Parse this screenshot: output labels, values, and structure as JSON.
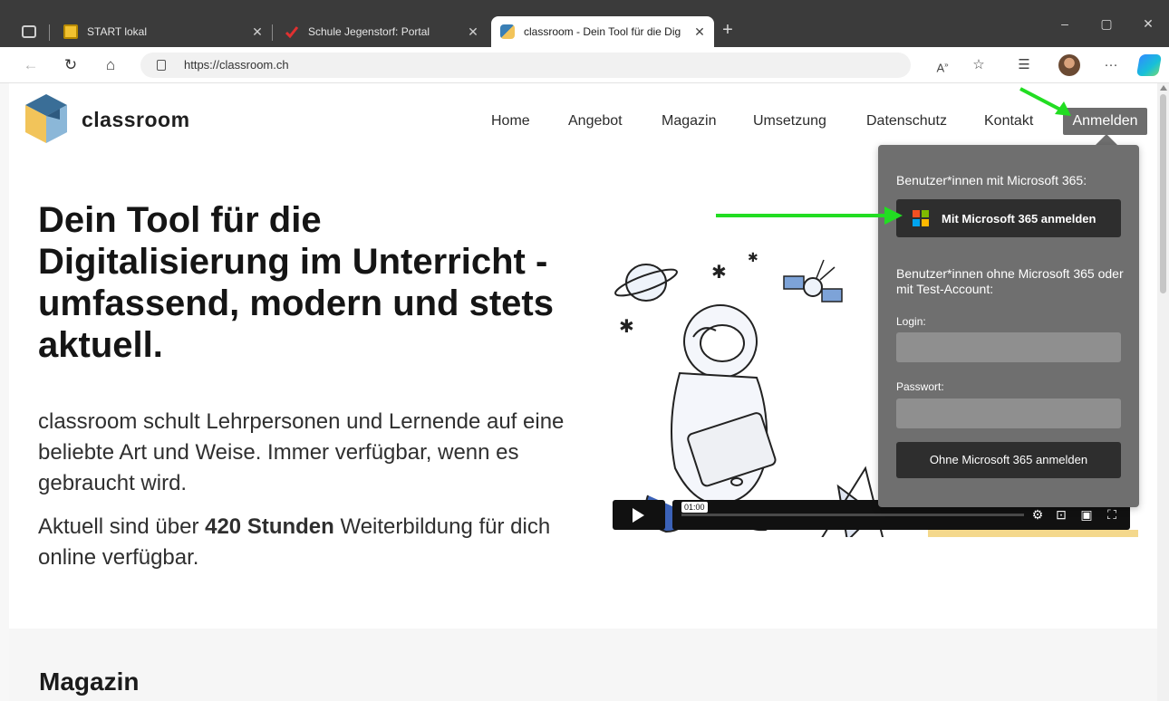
{
  "browser": {
    "tabs": [
      {
        "title": "START lokal",
        "active": false
      },
      {
        "title": "Schule Jegenstorf: Portal",
        "active": false
      },
      {
        "title": "classroom - Dein Tool für die Dig",
        "active": true
      }
    ],
    "url": "https://classroom.ch",
    "new_tab_icon": "+",
    "window_controls": [
      "–",
      "▢",
      "✕"
    ]
  },
  "site": {
    "brand": "classroom",
    "nav": [
      "Home",
      "Angebot",
      "Magazin",
      "Umsetzung",
      "Datenschutz",
      "Kontakt"
    ],
    "login_button": "Anmelden"
  },
  "hero": {
    "title": "Dein Tool für die Digitalisierung im Unterricht - umfassend, modern und stets aktuell.",
    "text": "classroom schult Lehrpersonen und Lernende auf eine beliebte Art und Weise. Immer verfügbar, wenn es gebraucht wird.",
    "text2_prefix": "Aktuell sind über ",
    "text2_bold": "420 Stunden",
    "text2_suffix": " Weiterbildung für dich online verfügbar."
  },
  "video": {
    "time": "01:00"
  },
  "login_dropdown": {
    "ms_heading": "Benutzer*innen mit Microsoft 365:",
    "ms_button": "Mit Microsoft 365 anmelden",
    "other_heading": "Benutzer*innen ohne Microsoft 365 oder mit Test-Account:",
    "login_label": "Login:",
    "password_label": "Passwort:",
    "submit_button": "Ohne Microsoft 365 anmelden"
  },
  "section": {
    "magazin_title": "Magazin"
  },
  "colors": {
    "tabbar": "#3b3b3b",
    "dropdown": "#6f6f6f",
    "annotation_arrow": "#22dd22",
    "ms_red": "#f25022",
    "ms_green": "#7fba00",
    "ms_blue": "#00a4ef",
    "ms_yellow": "#ffb900"
  }
}
